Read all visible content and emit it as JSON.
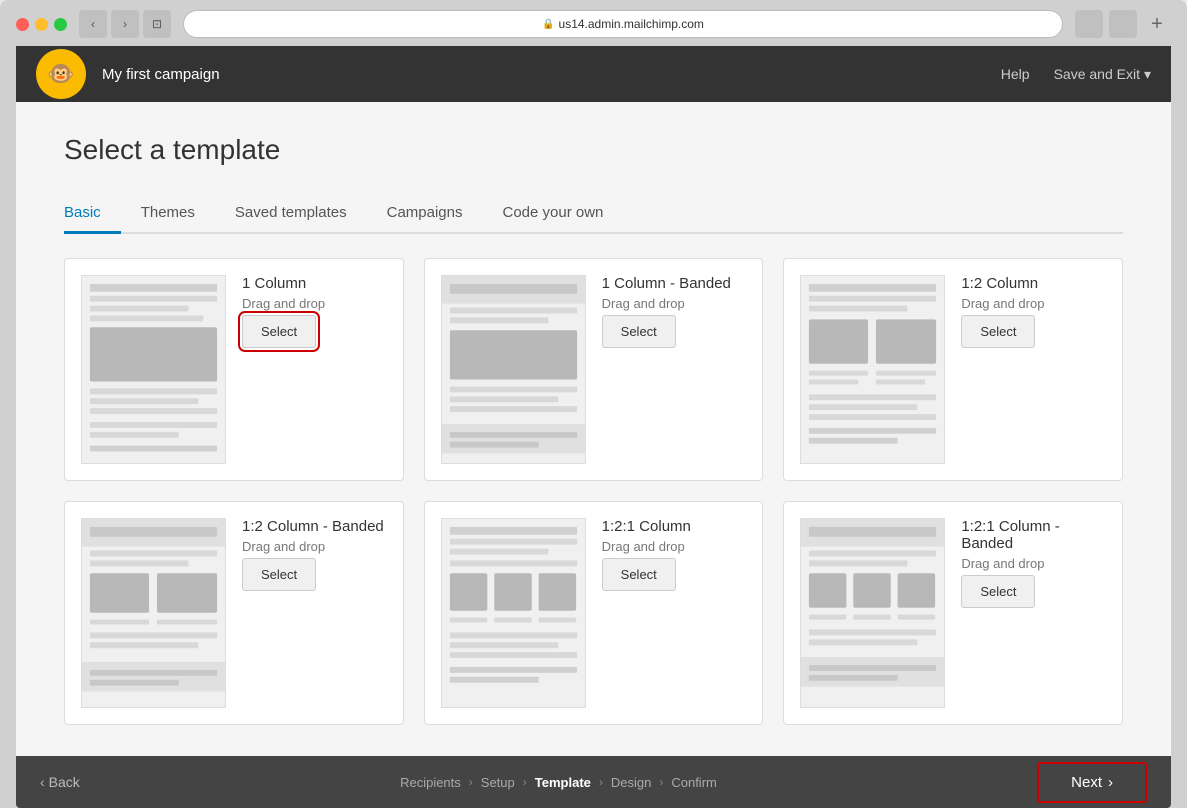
{
  "browser": {
    "url": "us14.admin.mailchimp.com"
  },
  "header": {
    "logo": "🐵",
    "campaign_name": "My first campaign",
    "help_label": "Help",
    "save_exit_label": "Save and Exit"
  },
  "page": {
    "title": "Select a template"
  },
  "tabs": [
    {
      "id": "basic",
      "label": "Basic",
      "active": true
    },
    {
      "id": "themes",
      "label": "Themes",
      "active": false
    },
    {
      "id": "saved",
      "label": "Saved templates",
      "active": false
    },
    {
      "id": "campaigns",
      "label": "Campaigns",
      "active": false
    },
    {
      "id": "code",
      "label": "Code your own",
      "active": false
    }
  ],
  "templates": [
    {
      "id": "1col",
      "name": "1 Column",
      "type": "Drag and drop",
      "select_label": "Select",
      "focused": true,
      "layout": "single"
    },
    {
      "id": "1col-banded",
      "name": "1 Column - Banded",
      "type": "Drag and drop",
      "select_label": "Select",
      "focused": false,
      "layout": "single-banded"
    },
    {
      "id": "12col",
      "name": "1:2 Column",
      "type": "Drag and drop",
      "select_label": "Select",
      "focused": false,
      "layout": "one-two"
    },
    {
      "id": "12col-banded",
      "name": "1:2 Column - Banded",
      "type": "Drag and drop",
      "select_label": "Select",
      "focused": false,
      "layout": "one-two-banded"
    },
    {
      "id": "121col",
      "name": "1:2:1 Column",
      "type": "Drag and drop",
      "select_label": "Select",
      "focused": false,
      "layout": "one-two-one"
    },
    {
      "id": "121col-banded",
      "name": "1:2:1 Column - Banded",
      "type": "Drag and drop",
      "select_label": "Select",
      "focused": false,
      "layout": "one-two-one-banded"
    }
  ],
  "footer": {
    "back_label": "Back",
    "next_label": "Next",
    "breadcrumbs": [
      {
        "label": "Recipients",
        "active": false
      },
      {
        "label": "Setup",
        "active": false
      },
      {
        "label": "Template",
        "active": true
      },
      {
        "label": "Design",
        "active": false
      },
      {
        "label": "Confirm",
        "active": false
      }
    ]
  }
}
